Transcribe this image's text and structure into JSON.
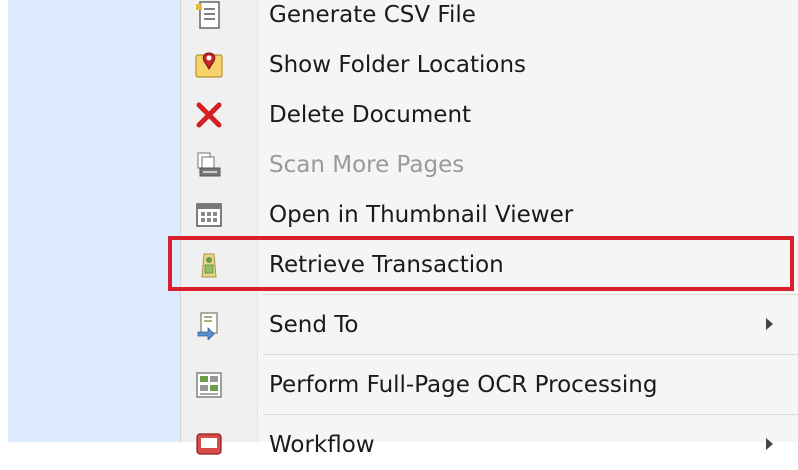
{
  "menu": {
    "items": [
      {
        "label": "Generate CSV File",
        "icon": "csv-file-icon",
        "disabled": false,
        "submenu": false
      },
      {
        "label": "Show Folder Locations",
        "icon": "folder-location-icon",
        "disabled": false,
        "submenu": false
      },
      {
        "label": "Delete Document",
        "icon": "delete-x-icon",
        "disabled": false,
        "submenu": false
      },
      {
        "label": "Scan More Pages",
        "icon": "scanner-icon",
        "disabled": true,
        "submenu": false
      },
      {
        "label": "Open in Thumbnail Viewer",
        "icon": "thumbnail-grid-icon",
        "disabled": false,
        "submenu": false
      },
      {
        "label": "Retrieve Transaction",
        "icon": "retrieve-transaction-icon",
        "disabled": false,
        "submenu": false,
        "highlighted": true
      },
      {
        "label": "Send To",
        "icon": "send-to-icon",
        "disabled": false,
        "submenu": true
      },
      {
        "label": "Perform Full-Page OCR Processing",
        "icon": "ocr-icon",
        "disabled": false,
        "submenu": false
      },
      {
        "label": "Workflow",
        "icon": "workflow-icon",
        "disabled": false,
        "submenu": true
      }
    ]
  },
  "colors": {
    "highlight_border": "#d9202a",
    "side_pane": "#ddebff",
    "menu_background": "#f5f5f5"
  }
}
